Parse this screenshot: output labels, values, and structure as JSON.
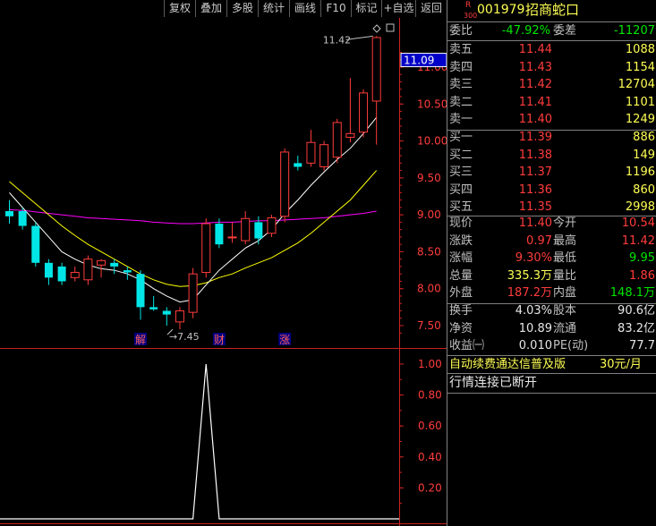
{
  "toolbar": {
    "buttons": [
      "复权",
      "叠加",
      "多股",
      "统计",
      "画线",
      "F10",
      "标记",
      "+自选",
      "返回"
    ]
  },
  "stock": {
    "r_badge": "R",
    "r_sub": "300",
    "code": "001979",
    "name": "招商蛇口"
  },
  "quote": {
    "weibi_label": "委比",
    "weibi": "-47.92%",
    "weicha_label": "委差",
    "weicha": "-11207",
    "asks": [
      {
        "label": "卖五",
        "price": "11.44",
        "vol": "1088"
      },
      {
        "label": "卖四",
        "price": "11.43",
        "vol": "1154"
      },
      {
        "label": "卖三",
        "price": "11.42",
        "vol": "12704"
      },
      {
        "label": "卖二",
        "price": "11.41",
        "vol": "1101"
      },
      {
        "label": "卖一",
        "price": "11.40",
        "vol": "1249"
      }
    ],
    "bids": [
      {
        "label": "买一",
        "price": "11.39",
        "vol": "886"
      },
      {
        "label": "买二",
        "price": "11.38",
        "vol": "149"
      },
      {
        "label": "买三",
        "price": "11.37",
        "vol": "1196"
      },
      {
        "label": "买四",
        "price": "11.36",
        "vol": "860"
      },
      {
        "label": "买五",
        "price": "11.35",
        "vol": "2998"
      }
    ],
    "stats": [
      {
        "l1": "现价",
        "v1": "11.40",
        "c1": "red",
        "l2": "今开",
        "v2": "10.54",
        "c2": "red"
      },
      {
        "l1": "涨跌",
        "v1": "0.97",
        "c1": "red",
        "l2": "最高",
        "v2": "11.42",
        "c2": "red"
      },
      {
        "l1": "涨幅",
        "v1": "9.30%",
        "c1": "red",
        "l2": "最低",
        "v2": "9.95",
        "c2": "green"
      },
      {
        "l1": "总量",
        "v1": "335.3万",
        "c1": "yellow",
        "l2": "量比",
        "v2": "1.86",
        "c2": "red"
      },
      {
        "l1": "外盘",
        "v1": "187.2万",
        "c1": "red",
        "l2": "内盘",
        "v2": "148.1万",
        "c2": "green"
      }
    ],
    "funds": [
      {
        "l1": "换手",
        "v1": "4.03%",
        "l2": "股本",
        "v2": "90.6亿"
      },
      {
        "l1": "净资",
        "v1": "10.89",
        "l2": "流通",
        "v2": "83.2亿"
      },
      {
        "l1": "收益㈠",
        "v1": "0.010",
        "l2": "PE(动)",
        "v2": "77.7"
      }
    ],
    "promo": "自动续费通达信普及版",
    "promo_price": "30元/月",
    "status": "行情连接已断开"
  },
  "colors": {
    "up": "#ff3c3c",
    "down": "#00e6e6",
    "ma5": "#ffffff",
    "ma10": "#ffff00",
    "ma20": "#ff00ff",
    "axis": "#cc2222",
    "grid": "#4a0000"
  },
  "chart_data": [
    {
      "type": "candlestick",
      "price_axis_ticks": [
        "11.00",
        "10.50",
        "10.00",
        "9.50",
        "9.00",
        "8.50",
        "8.00",
        "7.50"
      ],
      "current_price_tag": "11.09",
      "high_annotation": "11.42",
      "low_annotation": "7.45",
      "event_markers": [
        "解",
        "财",
        "涨"
      ],
      "candles": [
        {
          "o": 9.05,
          "h": 9.2,
          "l": 8.88,
          "c": 8.98
        },
        {
          "o": 9.05,
          "h": 9.1,
          "l": 8.8,
          "c": 8.85
        },
        {
          "o": 8.85,
          "h": 8.9,
          "l": 8.3,
          "c": 8.35
        },
        {
          "o": 8.35,
          "h": 8.4,
          "l": 8.05,
          "c": 8.15
        },
        {
          "o": 8.3,
          "h": 8.35,
          "l": 8.05,
          "c": 8.1
        },
        {
          "o": 8.15,
          "h": 8.3,
          "l": 8.1,
          "c": 8.22
        },
        {
          "o": 8.12,
          "h": 8.45,
          "l": 8.05,
          "c": 8.4
        },
        {
          "o": 8.32,
          "h": 8.4,
          "l": 8.15,
          "c": 8.38
        },
        {
          "o": 8.35,
          "h": 8.4,
          "l": 8.2,
          "c": 8.3
        },
        {
          "o": 8.25,
          "h": 8.3,
          "l": 8.12,
          "c": 8.22
        },
        {
          "o": 8.2,
          "h": 8.25,
          "l": 7.58,
          "c": 7.75
        },
        {
          "o": 7.75,
          "h": 7.9,
          "l": 7.7,
          "c": 7.72
        },
        {
          "o": 7.7,
          "h": 7.75,
          "l": 7.5,
          "c": 7.65
        },
        {
          "o": 7.55,
          "h": 7.75,
          "l": 7.45,
          "c": 7.7
        },
        {
          "o": 7.68,
          "h": 8.28,
          "l": 7.6,
          "c": 8.2
        },
        {
          "o": 8.22,
          "h": 8.95,
          "l": 8.15,
          "c": 8.88
        },
        {
          "o": 8.88,
          "h": 8.95,
          "l": 8.55,
          "c": 8.6
        },
        {
          "o": 8.7,
          "h": 8.9,
          "l": 8.62,
          "c": 8.7
        },
        {
          "o": 8.65,
          "h": 9.05,
          "l": 8.6,
          "c": 8.95
        },
        {
          "o": 8.9,
          "h": 8.98,
          "l": 8.6,
          "c": 8.68
        },
        {
          "o": 8.75,
          "h": 9.0,
          "l": 8.7,
          "c": 8.96
        },
        {
          "o": 8.98,
          "h": 9.9,
          "l": 8.9,
          "c": 9.85
        },
        {
          "o": 9.7,
          "h": 9.8,
          "l": 9.6,
          "c": 9.65
        },
        {
          "o": 9.7,
          "h": 10.15,
          "l": 9.65,
          "c": 9.98
        },
        {
          "o": 9.65,
          "h": 10.0,
          "l": 9.6,
          "c": 9.95
        },
        {
          "o": 9.78,
          "h": 10.3,
          "l": 9.7,
          "c": 10.25
        },
        {
          "o": 10.05,
          "h": 10.85,
          "l": 9.98,
          "c": 10.1
        },
        {
          "o": 10.12,
          "h": 10.7,
          "l": 10.05,
          "c": 10.65
        },
        {
          "o": 10.54,
          "h": 11.42,
          "l": 9.95,
          "c": 11.4
        }
      ],
      "ma_white": [
        9.3,
        9.1,
        8.9,
        8.7,
        8.5,
        8.4,
        8.32,
        8.27,
        8.25,
        8.2,
        8.12,
        8.0,
        7.9,
        7.82,
        7.85,
        8.05,
        8.25,
        8.4,
        8.55,
        8.65,
        8.8,
        9.02,
        9.2,
        9.4,
        9.58,
        9.75,
        9.9,
        10.1,
        10.32
      ],
      "ma_yellow": [
        9.45,
        9.3,
        9.15,
        9.0,
        8.85,
        8.72,
        8.6,
        8.5,
        8.4,
        8.3,
        8.2,
        8.12,
        8.06,
        8.03,
        8.04,
        8.08,
        8.15,
        8.2,
        8.28,
        8.35,
        8.42,
        8.52,
        8.62,
        8.75,
        8.9,
        9.05,
        9.2,
        9.4,
        9.6
      ],
      "ma_magenta": [
        9.07,
        9.06,
        9.04,
        9.02,
        9.0,
        8.98,
        8.96,
        8.95,
        8.94,
        8.93,
        8.92,
        8.9,
        8.89,
        8.88,
        8.88,
        8.89,
        8.9,
        8.9,
        8.91,
        8.92,
        8.92,
        8.93,
        8.94,
        8.95,
        8.96,
        8.98,
        9.0,
        9.02,
        9.05
      ]
    },
    {
      "type": "line",
      "y_axis_ticks": [
        "1.00",
        "0.80",
        "0.60",
        "0.40",
        "0.20"
      ],
      "ylim": [
        0,
        1
      ],
      "values": [
        0,
        0,
        0,
        0,
        0,
        0,
        0,
        0,
        0,
        0,
        0,
        0,
        0,
        0,
        0,
        1,
        0,
        0,
        0,
        0,
        0,
        0,
        0,
        0,
        0,
        0,
        0,
        0,
        0
      ]
    }
  ]
}
